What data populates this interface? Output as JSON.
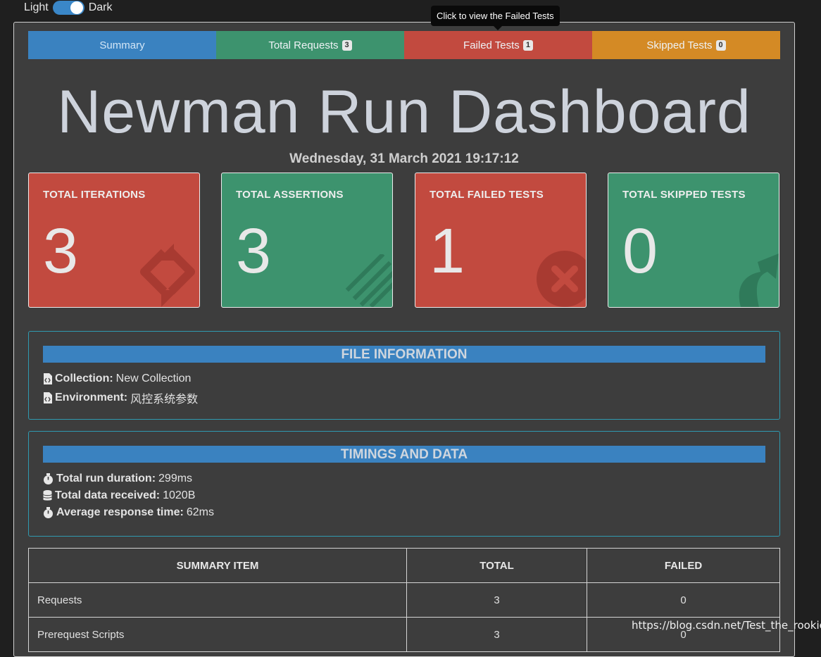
{
  "theme": {
    "light_label": "Light",
    "dark_label": "Dark",
    "selected": "Dark"
  },
  "tabs": [
    {
      "label": "Summary"
    },
    {
      "label": "Total Requests",
      "badge": "3"
    },
    {
      "label": "Failed Tests",
      "badge": "1"
    },
    {
      "label": "Skipped Tests",
      "badge": "0"
    }
  ],
  "tooltip": "Click to view the Failed Tests",
  "title": "Newman Run Dashboard",
  "date": "Wednesday, 31 March 2021 19:17:12",
  "cards": [
    {
      "label": "TOTAL ITERATIONS",
      "value": "3",
      "color": "#c24a3f",
      "icon": "sync-arrows-icon"
    },
    {
      "label": "TOTAL ASSERTIONS",
      "value": "3",
      "color": "#3d936e",
      "icon": "checklist-tasks-icon"
    },
    {
      "label": "TOTAL FAILED TESTS",
      "value": "1",
      "color": "#c24a3f",
      "icon": "times-circle-icon"
    },
    {
      "label": "TOTAL SKIPPED TESTS",
      "value": "0",
      "color": "#3d936e",
      "icon": "share-arrow-icon"
    }
  ],
  "file_info": {
    "heading": "FILE INFORMATION",
    "collection_label": "Collection:",
    "collection": "New Collection",
    "environment_label": "Environment:",
    "environment": "风控系统参数"
  },
  "timings": {
    "heading": "TIMINGS AND DATA",
    "duration_label": "Total run duration:",
    "duration": "299ms",
    "data_label": "Total data received:",
    "data": "1020B",
    "avg_label": "Average response time:",
    "avg": "62ms"
  },
  "summary_table": {
    "headers": [
      "SUMMARY ITEM",
      "TOTAL",
      "FAILED"
    ],
    "rows": [
      [
        "Requests",
        "3",
        "0"
      ],
      [
        "Prerequest Scripts",
        "3",
        "0"
      ]
    ]
  },
  "watermark": "https://blog.csdn.net/Test_the_rookie"
}
